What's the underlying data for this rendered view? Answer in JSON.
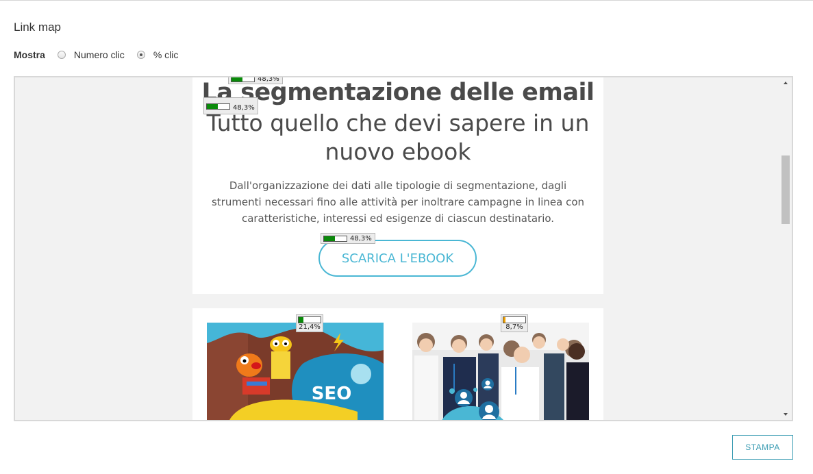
{
  "title": "Link map",
  "show": {
    "label": "Mostra",
    "options": [
      {
        "label": "Numero clic",
        "selected": false
      },
      {
        "label": "% clic",
        "selected": true
      }
    ]
  },
  "email": {
    "headline": "La segmentazione delle email",
    "subheadline": "Tutto quello che devi sapere in un nuovo ebook",
    "paragraph": "Dall'organizzazione dei dati alle tipologie di segmentazione, dagli strumenti necessari fino alle attività per inoltrare campagne in linea con caratteristiche, interessi ed esigenze di ciascun destinatario.",
    "cta_label": "SCARICA L'EBOOK",
    "seo_image_text": "SEO"
  },
  "link_badges": [
    {
      "label": "48,3%",
      "fraction": 0.483,
      "color": "#0a8a0a"
    },
    {
      "label": "48,3%",
      "fraction": 0.483,
      "color": "#0a8a0a"
    },
    {
      "label": "48,3%",
      "fraction": 0.483,
      "color": "#0a8a0a"
    },
    {
      "label": "21,4%",
      "fraction": 0.214,
      "color": "#0a8a0a"
    },
    {
      "label": "8,7%",
      "fraction": 0.087,
      "color": "#f0a000"
    }
  ],
  "print_button": "STAMPA"
}
